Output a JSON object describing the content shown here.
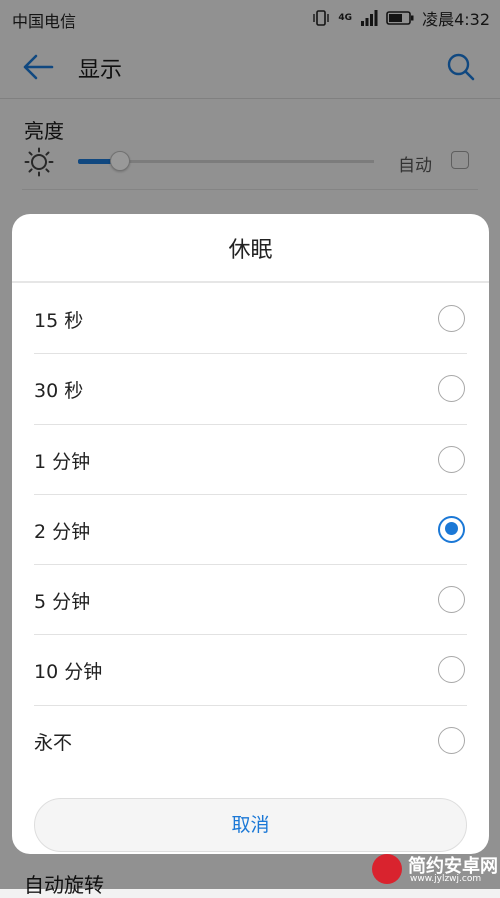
{
  "status_bar": {
    "carrier": "中国电信",
    "network": "4G",
    "time": "凌晨4:32"
  },
  "app_bar": {
    "title": "显示",
    "back_icon": "arrow-left-icon",
    "search_icon": "search-icon"
  },
  "settings": {
    "brightness_label": "亮度",
    "brightness_level": 0.14,
    "auto_label": "自动",
    "auto_checked": false,
    "partial_row_label": "自动旋转"
  },
  "dialog": {
    "title": "休眠",
    "options": [
      {
        "label": "15 秒",
        "selected": false
      },
      {
        "label": "30 秒",
        "selected": false
      },
      {
        "label": "1 分钟",
        "selected": false
      },
      {
        "label": "2 分钟",
        "selected": true
      },
      {
        "label": "5 分钟",
        "selected": false
      },
      {
        "label": "10 分钟",
        "selected": false
      },
      {
        "label": "永不",
        "selected": false
      }
    ],
    "cancel_label": "取消"
  },
  "watermark": {
    "name": "简约安卓网",
    "url": "www.jylzwj.com"
  },
  "colors": {
    "accent": "#1b78d6",
    "background": "#f2f2f2",
    "dialog_background": "#ffffff"
  }
}
